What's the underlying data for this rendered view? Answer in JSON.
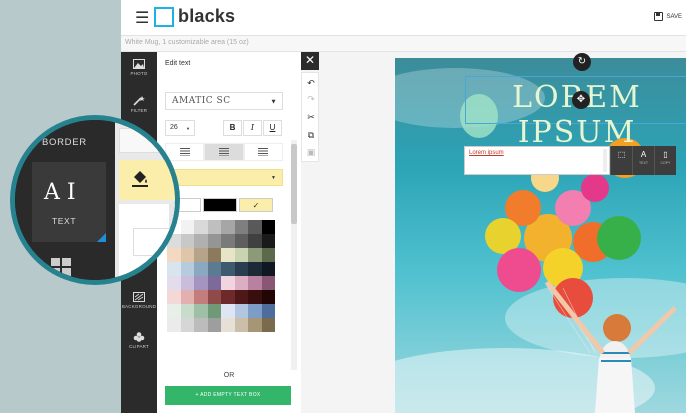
{
  "app": {
    "logo": "blacks",
    "save_label": "SAVE",
    "subtitle": "White Mug, 1 customizable area (15 oz)"
  },
  "left_nav": [
    {
      "label": "PHOTO",
      "icon": "image-icon"
    },
    {
      "label": "FILTER",
      "icon": "magic-wand-icon"
    },
    {
      "label": "BACKGROUND",
      "icon": "background-icon"
    },
    {
      "label": "CLIPART",
      "icon": "clipart-icon"
    }
  ],
  "edit_panel": {
    "title": "Edit text",
    "font": "AMATIC SC",
    "size": "26",
    "bold": "B",
    "italic": "I",
    "underline": "U",
    "checkmark": "✓",
    "or_label": "OR",
    "add_button": "+ ADD EMPTY TEXT BOX"
  },
  "palette_colors": [
    "#ffffff",
    "#f2f2f2",
    "#d9d9d9",
    "#bfbfbf",
    "#a6a6a6",
    "#7f7f7f",
    "#595959",
    "#000000",
    "#dcdcdc",
    "#c8c8c8",
    "#b0b0b0",
    "#959595",
    "#7a7a7a",
    "#5e5e5e",
    "#404040",
    "#1a1a1a",
    "#f3d9c2",
    "#e0c6a8",
    "#b5a48a",
    "#8b7a5c",
    "#e8e4c8",
    "#c9d3b2",
    "#8c9a79",
    "#5a6a4a",
    "#d8e4ee",
    "#b6cbdc",
    "#8aa8bf",
    "#5c7a92",
    "#3e5a6e",
    "#2a3e4f",
    "#1c2a38",
    "#0f1822",
    "#e3dced",
    "#c9bddb",
    "#a594c0",
    "#7c6a9a",
    "#f0d4e0",
    "#dcaec4",
    "#b7819f",
    "#8a5676",
    "#f4d7d7",
    "#e3b0b0",
    "#c47d7d",
    "#8f4a4a",
    "#6e2a2a",
    "#4f1818",
    "#380e0e",
    "#220606",
    "#e8efe9",
    "#c8dccc",
    "#9fbfa6",
    "#6f9a78",
    "#dde6f2",
    "#b3c6e0",
    "#7e9dc6",
    "#4d6e9c",
    "#ebebeb",
    "#d6d6d6",
    "#bcbcbc",
    "#9e9e9e",
    "#e6e0d6",
    "#cbbfa9",
    "#a69676",
    "#7a6a4e"
  ],
  "canvas": {
    "headline": "LOREM IPSUM",
    "text_input": "Lorem ipsum",
    "ctx_text_label": "TEXT",
    "ctx_copy_label": "COPY"
  },
  "zoom": {
    "border_label": "BORDER",
    "text_label": "TEXT",
    "text_icon": "A I"
  }
}
